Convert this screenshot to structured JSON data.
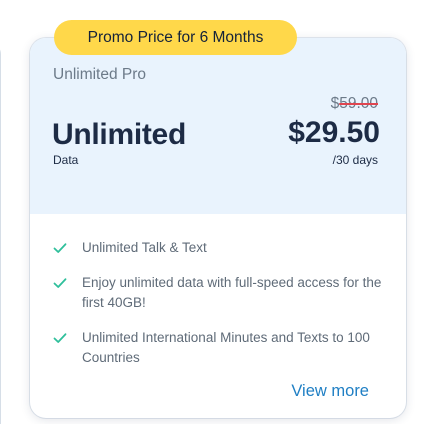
{
  "plan": {
    "promo_badge": "Promo Price for 6 Months",
    "name": "Unlimited Pro",
    "data_amount": "Unlimited",
    "data_label": "Data",
    "original_price_currency": "$",
    "original_price_amount": "59.00",
    "promo_price": "$29.50",
    "price_period": "/30 days",
    "features": [
      {
        "icon": "check-icon",
        "text": "Unlimited Talk & Text"
      },
      {
        "icon": "check-icon",
        "text": "Enjoy unlimited data with full-speed access for the first 40GB!"
      },
      {
        "icon": "check-icon",
        "text": "Unlimited International Minutes and Texts to 100 Countries"
      }
    ],
    "view_more_label": "View more"
  },
  "colors": {
    "badge_bg": "#ffd84a",
    "header_bg": "#e9f3fd",
    "check": "#2fbf9b",
    "link": "#1f7fc4",
    "strike": "#e0454f",
    "text_dark": "#1d2b45",
    "text_muted": "#6c7a89"
  }
}
